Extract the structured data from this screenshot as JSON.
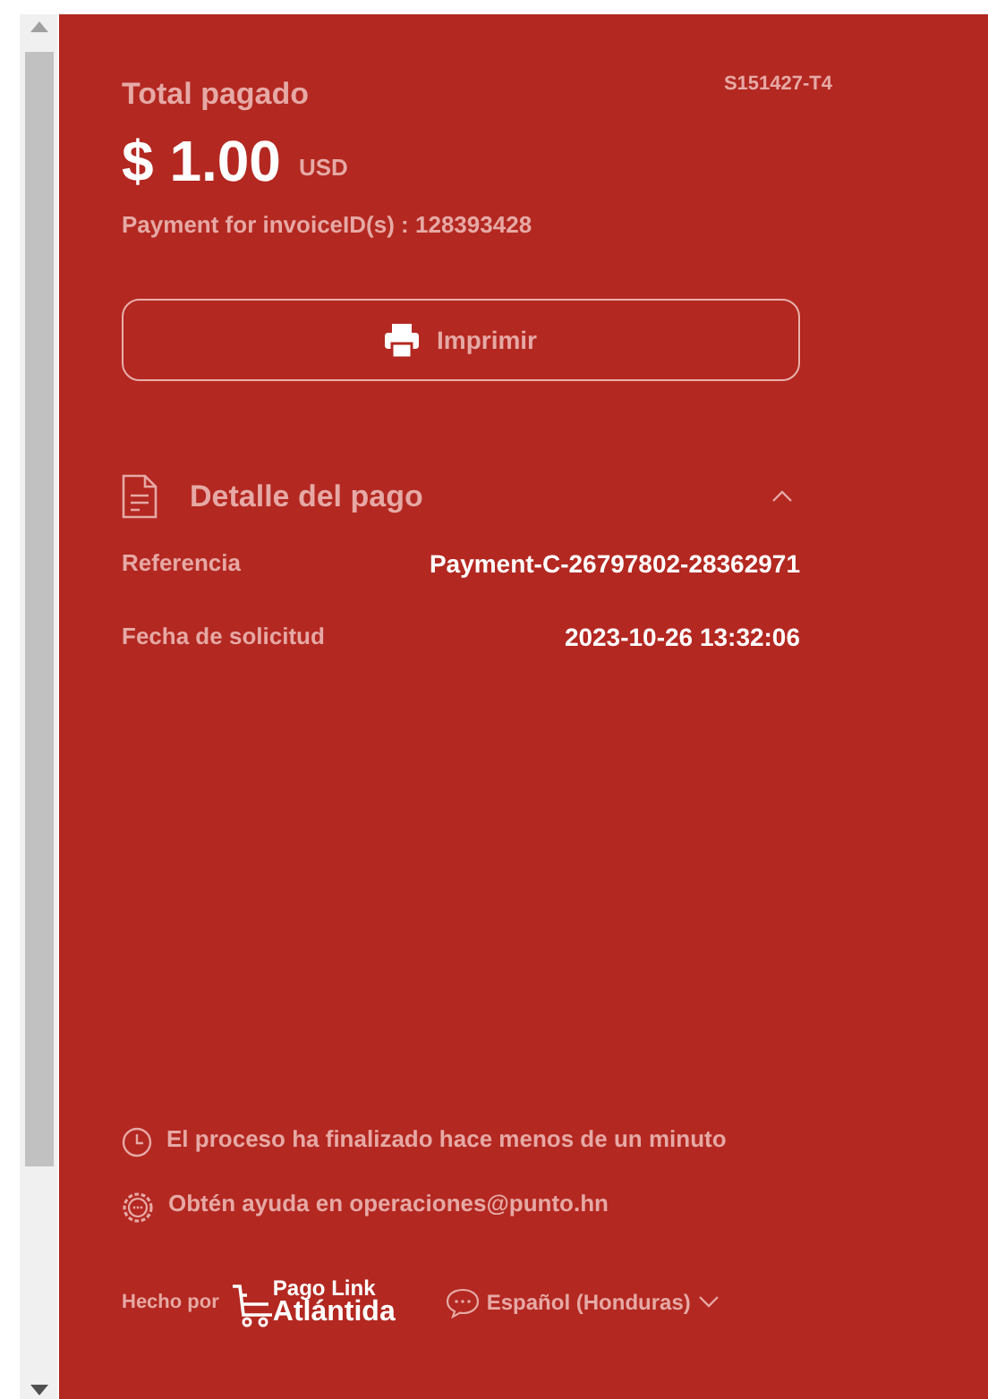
{
  "summary": {
    "title": "Total pagado",
    "code": "S151427-T4",
    "amount": "$ 1.00",
    "currency": "USD",
    "description": "Payment for invoiceID(s) : 128393428"
  },
  "print_button": {
    "label": "Imprimir"
  },
  "details": {
    "title": "Detalle del pago",
    "expanded": true,
    "rows": [
      {
        "label": "Referencia",
        "value": "Payment-C-26797802-28362971"
      },
      {
        "label": "Fecha de solicitud",
        "value": "2023-10-26 13:32:06"
      }
    ]
  },
  "notes": [
    {
      "kind": "clock",
      "text": "El proceso ha finalizado hace menos de un minuto"
    },
    {
      "kind": "help",
      "text": "Obtén ayuda en operaciones@punto.hn"
    }
  ],
  "footer": {
    "made_by": "Hecho por",
    "logo_top": "Pago Link",
    "logo_bottom": "Atlántida",
    "language": "Español (Honduras)"
  }
}
